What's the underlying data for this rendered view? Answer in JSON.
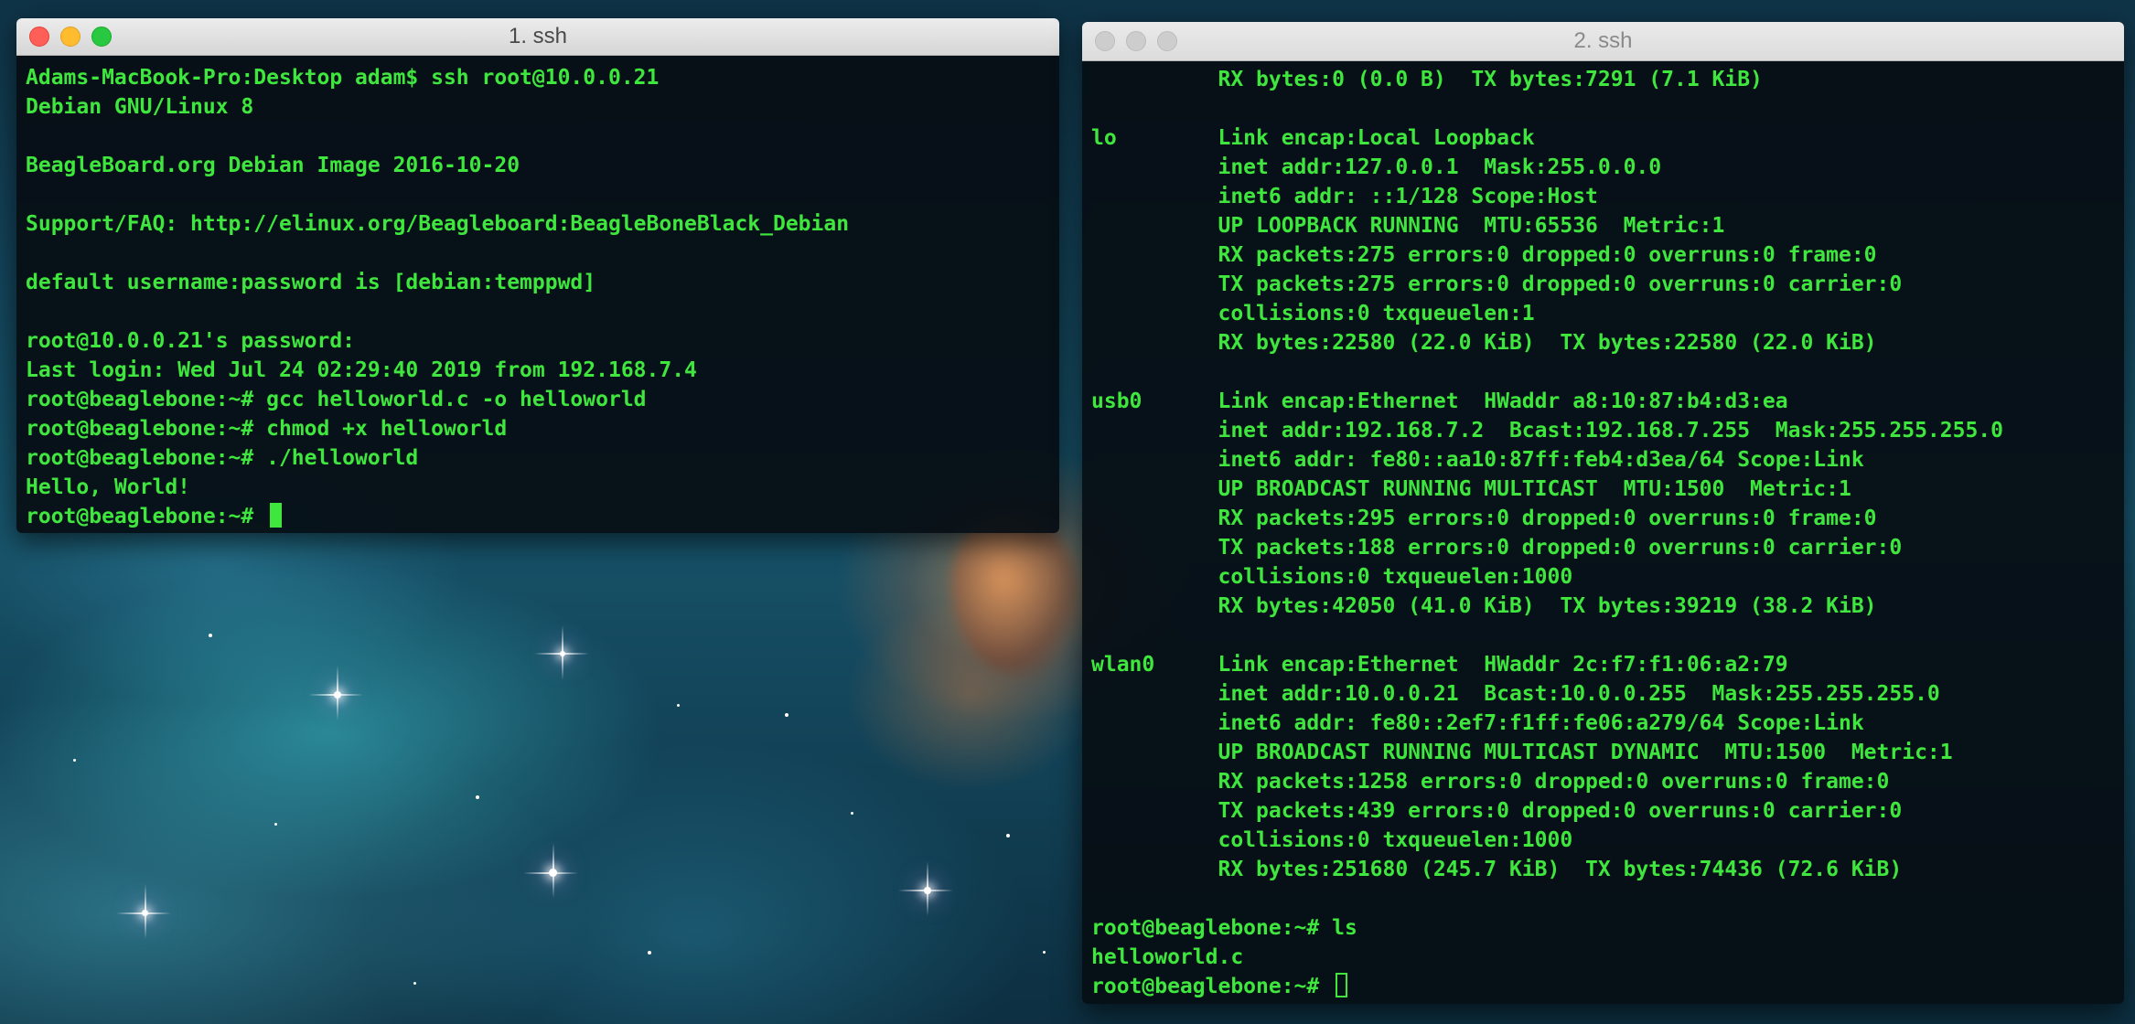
{
  "terminal_1": {
    "title": "1. ssh",
    "lines": [
      "Adams-MacBook-Pro:Desktop adam$ ssh root@10.0.0.21",
      "Debian GNU/Linux 8",
      "",
      "BeagleBoard.org Debian Image 2016-10-20",
      "",
      "Support/FAQ: http://elinux.org/Beagleboard:BeagleBoneBlack_Debian",
      "",
      "default username:password is [debian:temppwd]",
      "",
      "root@10.0.0.21's password:",
      "Last login: Wed Jul 24 02:29:40 2019 from 192.168.7.4",
      "root@beaglebone:~# gcc helloworld.c -o helloworld",
      "root@beaglebone:~# chmod +x helloworld",
      "root@beaglebone:~# ./helloworld",
      "Hello, World!"
    ],
    "prompt": "root@beaglebone:~# "
  },
  "terminal_2": {
    "title": "2. ssh",
    "lines": [
      "          RX bytes:0 (0.0 B)  TX bytes:7291 (7.1 KiB)",
      "",
      "lo        Link encap:Local Loopback",
      "          inet addr:127.0.0.1  Mask:255.0.0.0",
      "          inet6 addr: ::1/128 Scope:Host",
      "          UP LOOPBACK RUNNING  MTU:65536  Metric:1",
      "          RX packets:275 errors:0 dropped:0 overruns:0 frame:0",
      "          TX packets:275 errors:0 dropped:0 overruns:0 carrier:0",
      "          collisions:0 txqueuelen:1",
      "          RX bytes:22580 (22.0 KiB)  TX bytes:22580 (22.0 KiB)",
      "",
      "usb0      Link encap:Ethernet  HWaddr a8:10:87:b4:d3:ea",
      "          inet addr:192.168.7.2  Bcast:192.168.7.255  Mask:255.255.255.0",
      "          inet6 addr: fe80::aa10:87ff:feb4:d3ea/64 Scope:Link",
      "          UP BROADCAST RUNNING MULTICAST  MTU:1500  Metric:1",
      "          RX packets:295 errors:0 dropped:0 overruns:0 frame:0",
      "          TX packets:188 errors:0 dropped:0 overruns:0 carrier:0",
      "          collisions:0 txqueuelen:1000",
      "          RX bytes:42050 (41.0 KiB)  TX bytes:39219 (38.2 KiB)",
      "",
      "wlan0     Link encap:Ethernet  HWaddr 2c:f7:f1:06:a2:79",
      "          inet addr:10.0.0.21  Bcast:10.0.0.255  Mask:255.255.255.0",
      "          inet6 addr: fe80::2ef7:f1ff:fe06:a279/64 Scope:Link",
      "          UP BROADCAST RUNNING MULTICAST DYNAMIC  MTU:1500  Metric:1",
      "          RX packets:1258 errors:0 dropped:0 overruns:0 frame:0",
      "          TX packets:439 errors:0 dropped:0 overruns:0 carrier:0",
      "          collisions:0 txqueuelen:1000",
      "          RX bytes:251680 (245.7 KiB)  TX bytes:74436 (72.6 KiB)",
      "",
      "root@beaglebone:~# ls",
      "helloworld.c"
    ],
    "prompt": "root@beaglebone:~# "
  },
  "colors": {
    "terminal_text": "#3ee63e",
    "terminal_bg": "#060e14",
    "close_button": "#ff5f57",
    "minimize_button": "#febc2e",
    "zoom_button": "#28c840",
    "inactive_button": "#cdcdcd"
  },
  "icons": {
    "close": "close-button",
    "minimize": "minimize-button",
    "zoom": "zoom-button",
    "cursor": "terminal-cursor"
  }
}
